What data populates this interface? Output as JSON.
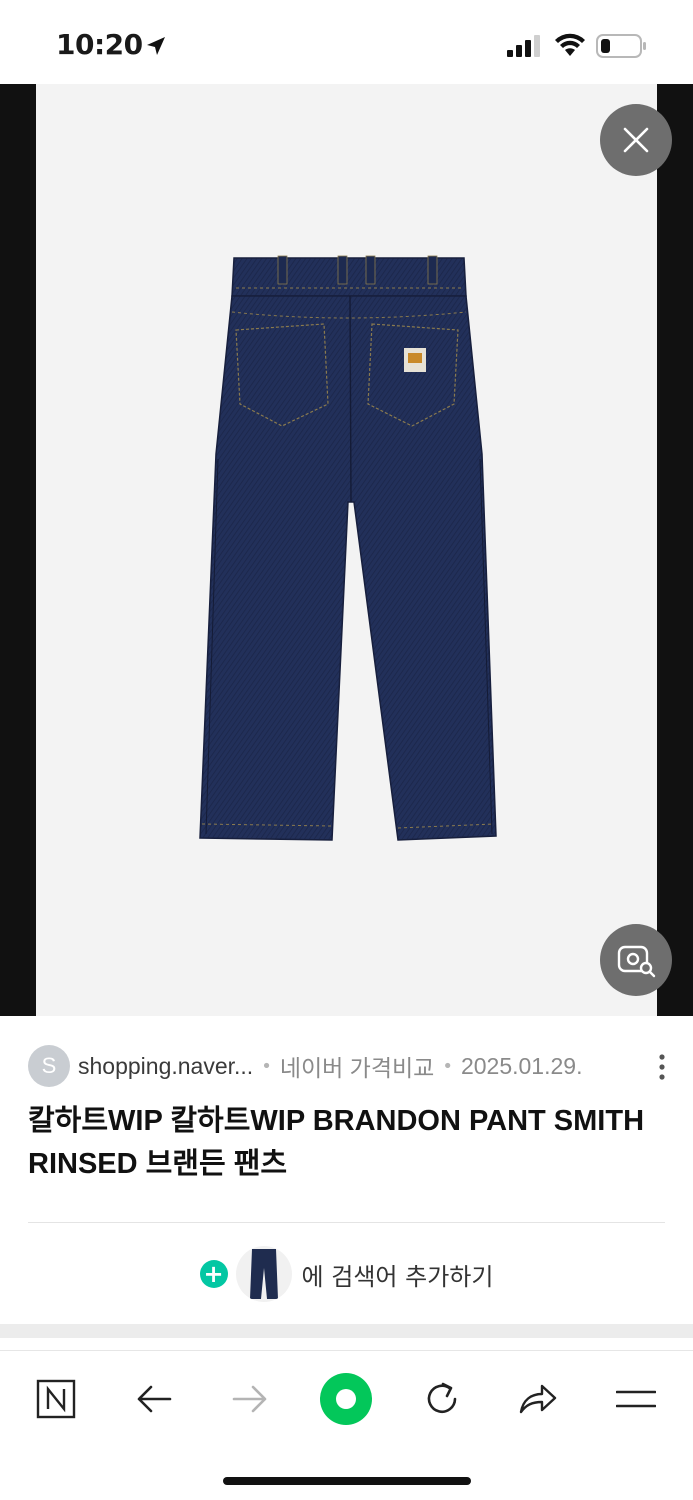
{
  "status_bar": {
    "time": "10:20",
    "icons": [
      "location-arrow-icon",
      "cellular-signal-icon",
      "wifi-icon",
      "battery-icon"
    ]
  },
  "viewer": {
    "image_subject": "dark indigo rinsed denim wide-leg pants, back view",
    "close_icon": "close-icon",
    "lens_icon": "image-search-icon"
  },
  "result": {
    "source_initial": "S",
    "source_domain": "shopping.naver...",
    "service": "네이버 가격비교",
    "date": "2025.01.29.",
    "title": "칼하트WIP 칼하트WIP BRANDON PANT SMITH RINSED 브랜든 팬츠"
  },
  "add_keyword": {
    "plus": "+",
    "label": "에 검색어 추가하기"
  },
  "toolbar": {
    "buttons": [
      "naver-home-icon",
      "back-arrow-icon",
      "forward-arrow-icon",
      "green-dot-button",
      "reload-icon",
      "share-icon",
      "menu-icon"
    ]
  },
  "colors": {
    "accent": "#03c75a",
    "plus_badge": "#03c7a3",
    "denim": "#1f2c4f"
  }
}
